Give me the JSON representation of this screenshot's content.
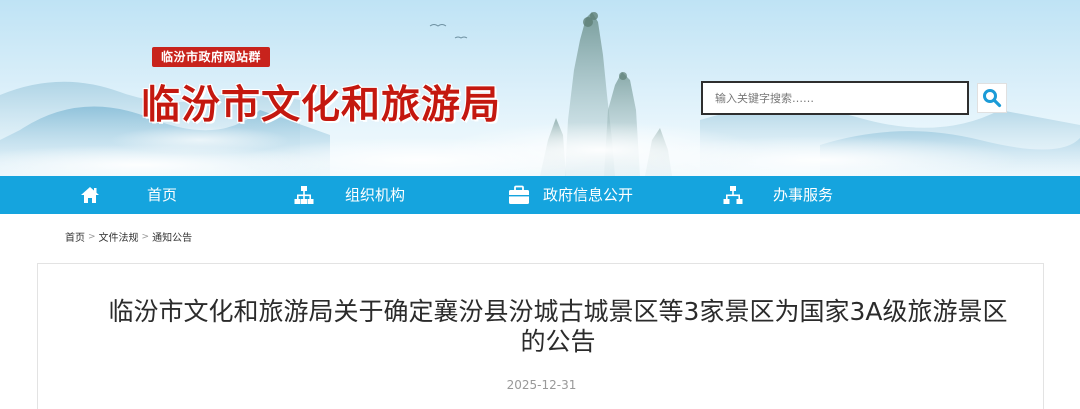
{
  "header": {
    "site_group_tag": "临汾市政府网站群",
    "site_title": "临汾市文化和旅游局",
    "search_placeholder": "输入关键字搜索……"
  },
  "nav": {
    "items": [
      {
        "label": "首页",
        "icon": "home-icon"
      },
      {
        "label": "组织机构",
        "icon": "org-chart-icon"
      },
      {
        "label": "政府信息公开",
        "icon": "briefcase-icon"
      },
      {
        "label": "办事服务",
        "icon": "sitemap-icon"
      }
    ]
  },
  "breadcrumb": {
    "items": [
      "首页",
      "文件法规",
      "通知公告"
    ],
    "separator": ">"
  },
  "article": {
    "title": "临汾市文化和旅游局关于确定襄汾县汾城古城景区等3家景区为国家3A级旅游景区的公告",
    "date": "2025-12-31"
  },
  "colors": {
    "nav_bg": "#15a4de",
    "title_red": "#c4180f",
    "tag_red": "#c8231c"
  }
}
